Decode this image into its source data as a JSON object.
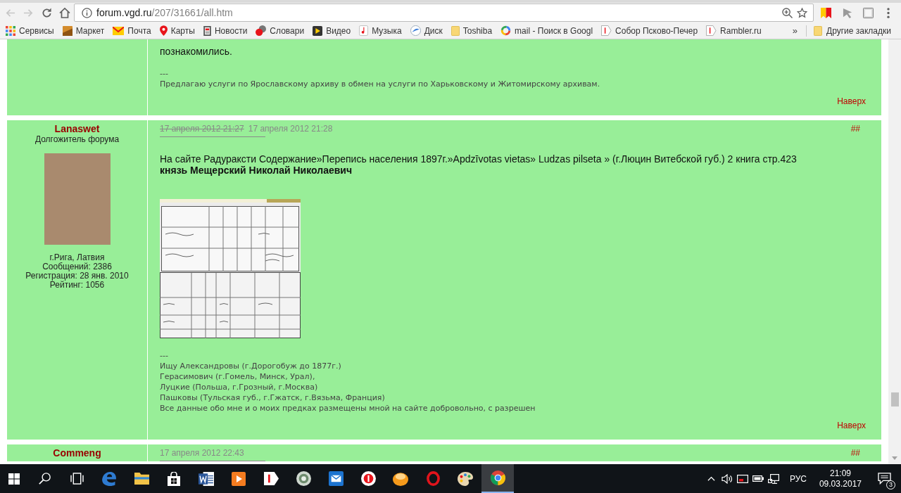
{
  "browser": {
    "back": {
      "disabled": true
    },
    "forward": {
      "disabled": true
    },
    "url": {
      "host": "forum.vgd.ru",
      "path": "/207/31661/all.htm"
    },
    "bookmarks": [
      {
        "label": "Сервисы",
        "kind": "apps"
      },
      {
        "label": "Маркет",
        "kind": "market"
      },
      {
        "label": "Почта",
        "kind": "mail"
      },
      {
        "label": "Карты",
        "kind": "maps"
      },
      {
        "label": "Новости",
        "kind": "news"
      },
      {
        "label": "Словари",
        "kind": "dict"
      },
      {
        "label": "Видео",
        "kind": "video"
      },
      {
        "label": "Музыка",
        "kind": "music"
      },
      {
        "label": "Диск",
        "kind": "disk"
      },
      {
        "label": "Toshiba",
        "kind": "folder"
      },
      {
        "label": "mail - Поиск в Googl",
        "kind": "google"
      },
      {
        "label": "Собор Псково-Печер",
        "kind": "page"
      },
      {
        "label": "Rambler.ru",
        "kind": "page"
      }
    ],
    "overflow": "»",
    "other_bookmarks": "Другие закладки"
  },
  "posts": [
    {
      "body": [
        {
          "kind": "text",
          "text": "познакомились."
        }
      ],
      "separator": "---",
      "signature": [
        "Предлагаю услуги по Ярославскому архиву в обмен на услуги по Харьковскому и Житомирскому архивам."
      ],
      "top_link": "Наверх"
    },
    {
      "author": {
        "name": "Lanaswet",
        "rank": "Долгожитель форума",
        "avatar": true,
        "details": [
          "г.Рига, Латвия",
          "Сообщений: 2386",
          "Регистрация: 28 янв. 2010",
          "Рейтинг: 1056"
        ]
      },
      "edited_date": "17 апреля 2012 21:27",
      "date": "17 апреля 2012 21:28",
      "anchor": "##",
      "body": [
        {
          "kind": "text",
          "text": "На сайте Радураксти Содержание»Перепись населения 1897г.»Apdzīvotas vietas» Ludzas pilseta » (г.Люцин Витебской губ.) 2 книга стр.423"
        },
        {
          "kind": "bold",
          "text": "князь Мещерский Николай Николаевич"
        },
        {
          "kind": "image"
        }
      ],
      "separator": "---",
      "signature": [
        "Ищу Александровы (г.Дорогобуж до 1877г.)",
        "Герасимович (г.Гомель, Минск, Урал),",
        "Луцкие (Польша, г.Грозный, г.Москва)",
        "Пашковы (Тульская губ., г.Гжатск, г.Вязьма, Франция)",
        "Все данные обо мне и о моих предках размещены мной на сайте добровольно, с разрешен"
      ],
      "top_link": "Наверх"
    },
    {
      "author": {
        "name": "Commeng"
      },
      "date": "17 апреля 2012 22:43",
      "anchor": "##"
    }
  ],
  "taskbar": {
    "apps": [
      {
        "kind": "start",
        "active": false
      },
      {
        "kind": "search",
        "active": false
      },
      {
        "kind": "taskview",
        "active": false
      },
      {
        "kind": "edge",
        "active": false
      },
      {
        "kind": "explorer",
        "active": false
      },
      {
        "kind": "store",
        "active": false
      },
      {
        "kind": "word",
        "active": false
      },
      {
        "kind": "media",
        "active": false
      },
      {
        "kind": "yandex",
        "active": false
      },
      {
        "kind": "disc",
        "active": false
      },
      {
        "kind": "mail",
        "active": false
      },
      {
        "kind": "ybrowser",
        "active": false
      },
      {
        "kind": "orange",
        "active": false
      },
      {
        "kind": "opera",
        "active": false
      },
      {
        "kind": "paint",
        "active": false
      },
      {
        "kind": "chrome",
        "active": true
      }
    ],
    "tray": {
      "language": "РУС",
      "time": "21:09",
      "date": "09.03.2017",
      "notifications": "3"
    }
  }
}
